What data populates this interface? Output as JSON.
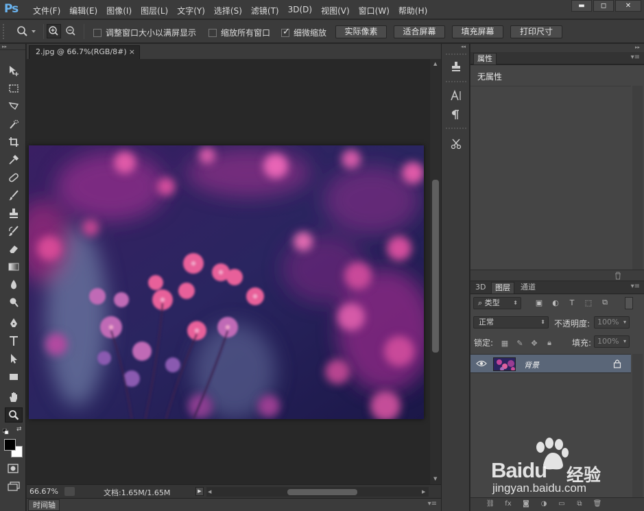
{
  "app": {
    "logo": "Ps"
  },
  "menu": [
    "文件(F)",
    "编辑(E)",
    "图像(I)",
    "图层(L)",
    "文字(Y)",
    "选择(S)",
    "滤镜(T)",
    "3D(D)",
    "视图(V)",
    "窗口(W)",
    "帮助(H)"
  ],
  "window_controls": {
    "minimize": "▬",
    "restore": "◻",
    "close": "✕"
  },
  "options": {
    "resize_windows": {
      "label": "调整窗口大小以满屏显示",
      "checked": false
    },
    "zoom_all_windows": {
      "label": "缩放所有窗口",
      "checked": false
    },
    "scrubby_zoom": {
      "label": "细微缩放",
      "checked": true
    },
    "buttons": [
      "实际像素",
      "适合屏幕",
      "填充屏幕",
      "打印尺寸"
    ]
  },
  "document": {
    "tab_title": "2.jpg @ 66.7%(RGB/8#)",
    "close": "×",
    "zoom": "66.67%",
    "doc_info": "文档:1.65M/1.65M"
  },
  "timeline": {
    "label": "时间轴"
  },
  "properties": {
    "tab": "属性",
    "empty_text": "无属性"
  },
  "layers_panel": {
    "tabs": [
      "3D",
      "图层",
      "通道"
    ],
    "active_tab": "图层",
    "filter_label": "类型",
    "blend_mode": "正常",
    "opacity_label": "不透明度:",
    "opacity_value": "100%",
    "lock_label": "锁定:",
    "fill_label": "填充:",
    "fill_value": "100%",
    "layers": [
      {
        "name": "背景",
        "visible": true,
        "locked": true
      }
    ]
  },
  "watermark": {
    "brand": "Baidu",
    "brand_cn": "经验",
    "url": "jingyan.baidu.com"
  },
  "colors": {
    "foreground": "#000000",
    "background": "#ffffff",
    "ps_blue": "#6ab4f0",
    "selected_layer": "#5a6678"
  }
}
